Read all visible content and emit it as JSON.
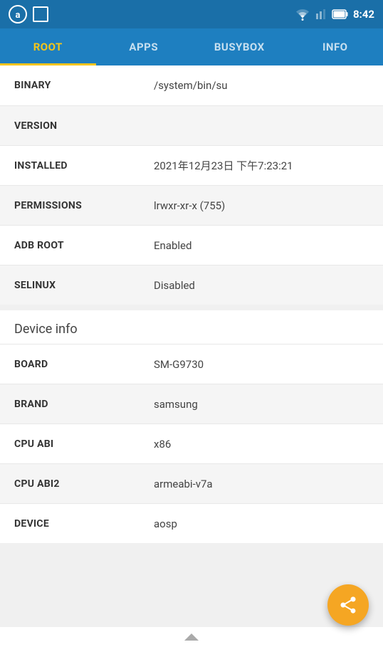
{
  "statusBar": {
    "time": "8:42"
  },
  "tabs": [
    {
      "id": "root",
      "label": "ROOT",
      "active": true
    },
    {
      "id": "apps",
      "label": "APPS",
      "active": false
    },
    {
      "id": "busybox",
      "label": "BUSYBOX",
      "active": false
    },
    {
      "id": "info",
      "label": "INFO",
      "active": false
    }
  ],
  "rootInfo": {
    "rows": [
      {
        "label": "BINARY",
        "value": "/system/bin/su",
        "shaded": false
      },
      {
        "label": "VERSION",
        "value": "",
        "shaded": true
      },
      {
        "label": "INSTALLED",
        "value": "2021年12月23日 下午7:23:21",
        "shaded": false
      },
      {
        "label": "PERMISSIONS",
        "value": "lrwxr-xr-x (755)",
        "shaded": true
      },
      {
        "label": "ADB ROOT",
        "value": "Enabled",
        "shaded": false
      },
      {
        "label": "SELINUX",
        "value": "Disabled",
        "shaded": true
      }
    ]
  },
  "deviceInfo": {
    "sectionTitle": "Device info",
    "rows": [
      {
        "label": "BOARD",
        "value": "SM-G9730",
        "shaded": false
      },
      {
        "label": "BRAND",
        "value": "samsung",
        "shaded": true
      },
      {
        "label": "CPU ABI",
        "value": "x86",
        "shaded": false
      },
      {
        "label": "CPU ABI2",
        "value": "armeabi-v7a",
        "shaded": true
      },
      {
        "label": "DEVICE",
        "value": "aosp",
        "shaded": false
      }
    ]
  },
  "fab": {
    "label": "share"
  }
}
